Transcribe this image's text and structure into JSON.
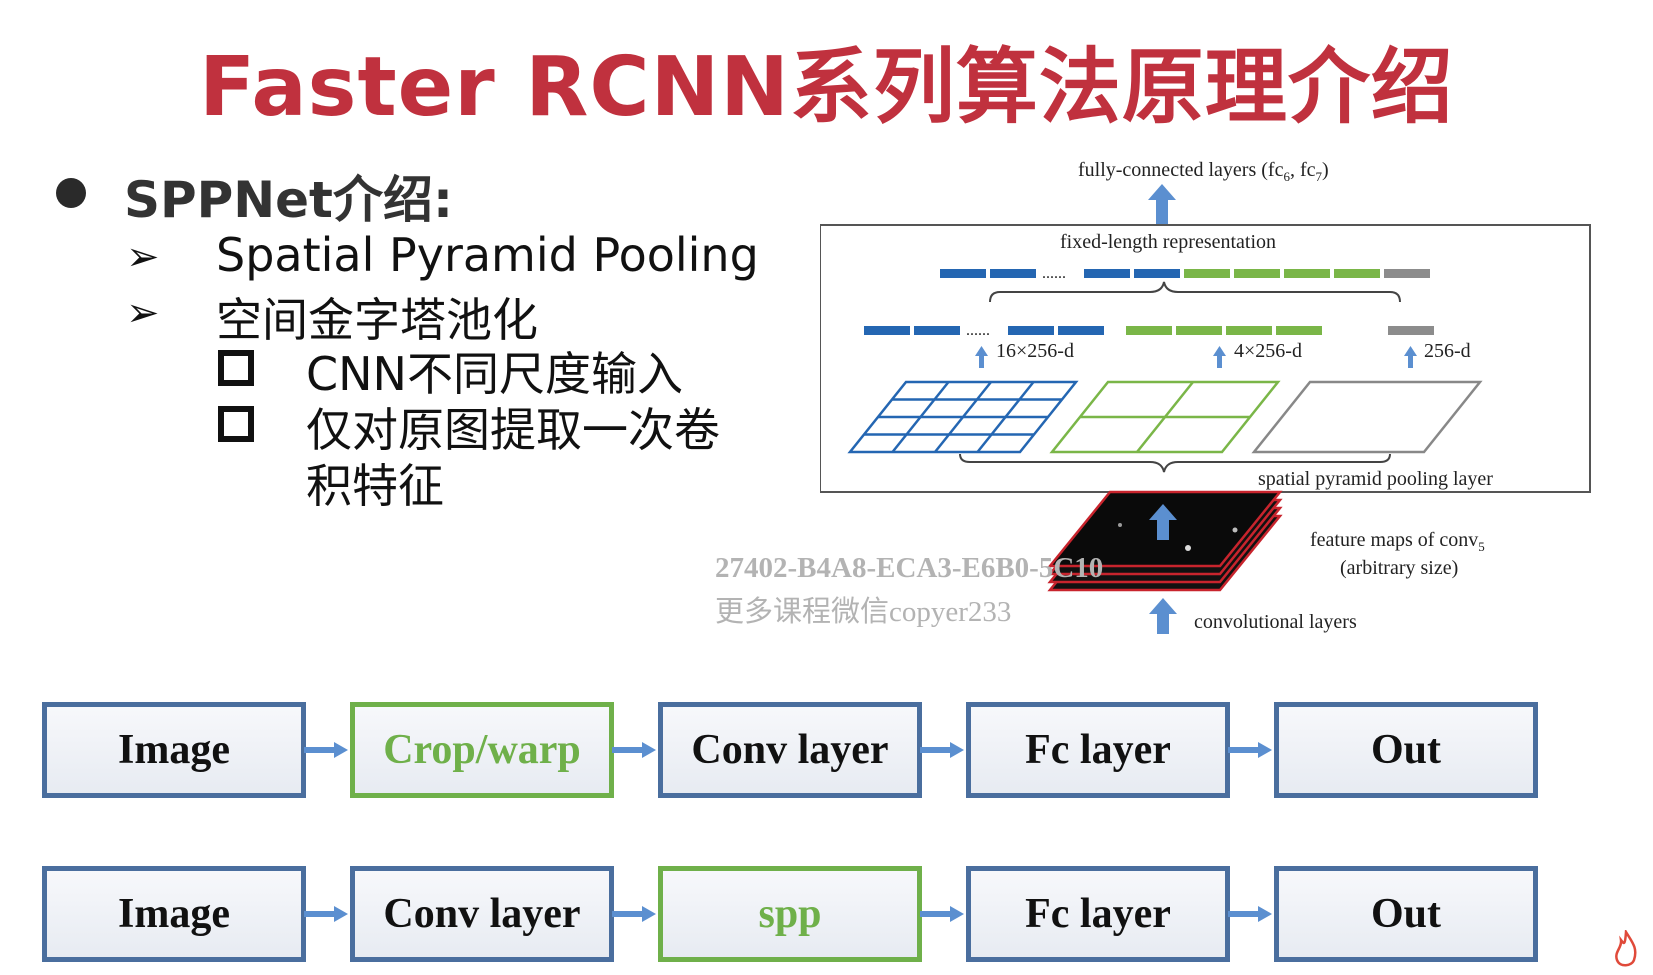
{
  "title": "Faster RCNN系列算法原理介绍",
  "section": {
    "heading": "SPPNet介绍:",
    "items": [
      {
        "label": "Spatial Pyramid Pooling"
      },
      {
        "label": "空间金字塔池化"
      }
    ],
    "subitems": [
      {
        "label": "CNN不同尺度输入"
      },
      {
        "label": "仅对原图提取一次卷",
        "label_cont": "积特征"
      }
    ]
  },
  "figure": {
    "top_label": "fully-connected layers (fc",
    "top_label_sub1": "6",
    "top_label_mid": ", fc",
    "top_label_sub2": "7",
    "top_label_end": ")",
    "fixed_label": "fixed-length representation",
    "dots": "......",
    "bin_labels": [
      "16×256-d",
      "4×256-d",
      "256-d"
    ],
    "spp_label": "spatial pyramid pooling layer",
    "feature_label_1": "feature maps of conv",
    "feature_label_sub": "5",
    "feature_label_2": "(arbitrary size)",
    "conv_label": "convolutional layers",
    "colors": {
      "blue": "#2466b2",
      "green": "#7ab648",
      "gray": "#8c8c8c",
      "arrow": "#5b8fd0"
    }
  },
  "watermark": {
    "line1": "27402-B4A8-ECA3-E6B0-5C10",
    "line2": "更多课程微信copyer233"
  },
  "pipelines": [
    {
      "boxes": [
        {
          "label": "Image",
          "style": "blue"
        },
        {
          "label": "Crop/warp",
          "style": "green"
        },
        {
          "label": "Conv layer",
          "style": "blue"
        },
        {
          "label": "Fc layer",
          "style": "blue"
        },
        {
          "label": "Out",
          "style": "blue"
        }
      ]
    },
    {
      "boxes": [
        {
          "label": "Image",
          "style": "blue"
        },
        {
          "label": "Conv layer",
          "style": "blue"
        },
        {
          "label": "spp",
          "style": "green"
        },
        {
          "label": "Fc layer",
          "style": "blue"
        },
        {
          "label": "Out",
          "style": "blue"
        }
      ]
    }
  ]
}
